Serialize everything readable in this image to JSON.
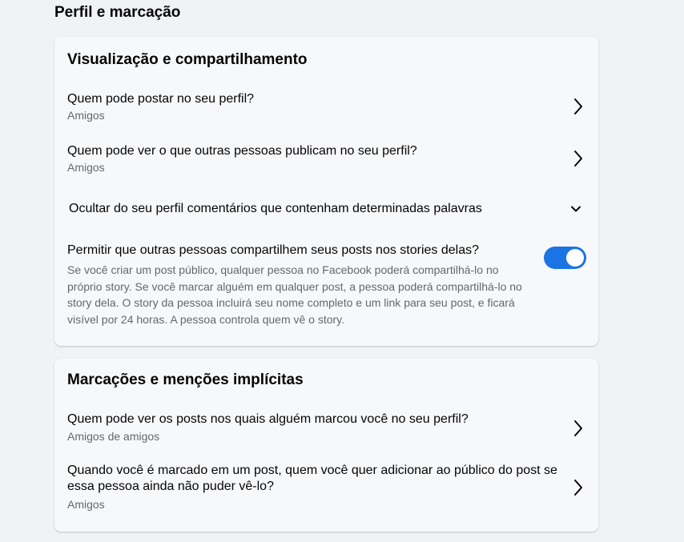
{
  "page": {
    "title": "Perfil e marcação"
  },
  "sections": [
    {
      "title": "Visualização e compartilhamento",
      "items": [
        {
          "label": "Quem pode postar no seu perfil?",
          "value": "Amigos"
        },
        {
          "label": "Quem pode ver o que outras pessoas publicam no seu perfil?",
          "value": "Amigos"
        },
        {
          "label": "Ocultar do seu perfil comentários que contenham determinadas palavras"
        },
        {
          "label": "Permitir que outras pessoas compartilhem seus posts nos stories delas?",
          "description": "Se você criar um post público, qualquer pessoa no Facebook poderá compartilhá-lo no próprio story. Se você marcar alguém em qualquer post, a pessoa poderá compartilhá-lo no story dela. O story da pessoa incluirá seu nome completo e um link para seu post, e ficará visível por 24 horas. A pessoa controla quem vê o story.",
          "toggle_on": true
        }
      ]
    },
    {
      "title": "Marcações e menções implícitas",
      "items": [
        {
          "label": "Quem pode ver os posts nos quais alguém marcou você no seu perfil?",
          "value": "Amigos de amigos"
        },
        {
          "label": "Quando você é marcado em um post, quem você quer adicionar ao público do post se essa pessoa ainda não puder vê-lo?",
          "value": "Amigos"
        }
      ]
    }
  ],
  "icons": {
    "row_arrow": "chevron-right-icon",
    "expand_arrow": "chevron-down-icon"
  },
  "colors": {
    "accent": "#1b74e4",
    "background": "#f0f2f5",
    "card": "#f7f8fa",
    "secondary_text": "#65676b"
  }
}
